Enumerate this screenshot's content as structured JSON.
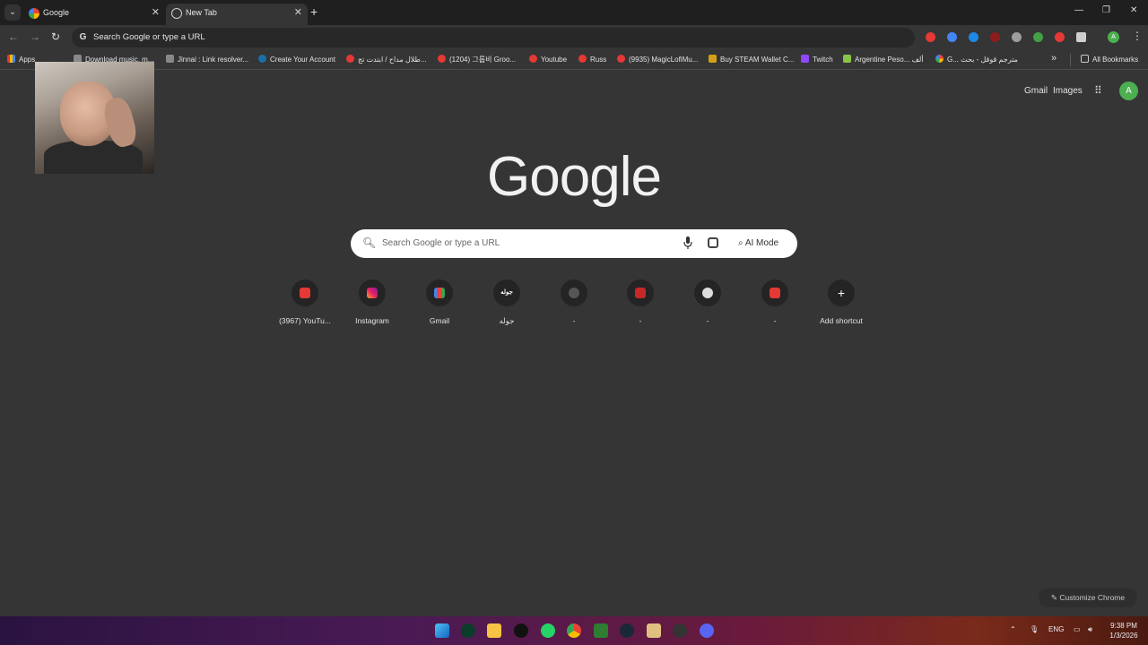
{
  "window": {
    "tabs": [
      {
        "title": "Google",
        "active": false
      },
      {
        "title": "New Tab",
        "active": true
      }
    ],
    "close_glyph": "✕",
    "new_tab_glyph": "+",
    "minimize_glyph": "—",
    "restore_glyph": "❐",
    "close_window_glyph": "✕"
  },
  "toolbar": {
    "omnibox_text": "Search Google or type a URL",
    "omnibox_icon": "G",
    "profile_initial": "A",
    "extensions": [
      "#e53935",
      "#4285f4",
      "#1e88e5",
      "#8d1c1c",
      "#9e9e9e",
      "#43a047",
      "#e53935",
      "#cfcfcf"
    ]
  },
  "bookmarks": {
    "items": [
      {
        "label": "Apps",
        "icon": "ic-apps"
      },
      {
        "label": "Download music, m...",
        "icon": "ic-gray"
      },
      {
        "label": "Jinnai : Link resolver...",
        "icon": "ic-gray"
      },
      {
        "label": "Create Your Account",
        "icon": "ic-steam"
      },
      {
        "label": "طلال مداح / ابتدت تج...",
        "icon": "ic-yt"
      },
      {
        "label": "(1204) 그룹비 Groo...",
        "icon": "ic-yt"
      },
      {
        "label": "Youtube",
        "icon": "ic-yt"
      },
      {
        "label": "Russ",
        "icon": "ic-yt"
      },
      {
        "label": "(9935) MagicLofiMu...",
        "icon": "ic-yt"
      },
      {
        "label": "Buy STEAM Wallet C...",
        "icon": "ic-shield"
      },
      {
        "label": "Twitch",
        "icon": "ic-twitch"
      },
      {
        "label": "Argentine Peso... ألف",
        "icon": "ic-seven"
      },
      {
        "label": "G... مترجم قوقل - بحث",
        "icon": "ic-g"
      }
    ],
    "more_glyph": "»",
    "all_bookmarks": "All Bookmarks"
  },
  "ntp": {
    "gmail": "Gmail",
    "images": "Images",
    "avatar_initial": "A",
    "logo": "Google",
    "search_placeholder": "Search Google or type a URL",
    "ai_mode": "AI Mode",
    "shortcuts": [
      {
        "label": "(3967) YouTu...",
        "icon": "sic-yt",
        "glyph": ""
      },
      {
        "label": "Instagram",
        "icon": "sic-ig",
        "glyph": ""
      },
      {
        "label": "Gmail",
        "icon": "sic-gm",
        "glyph": ""
      },
      {
        "label": "جوله",
        "icon": "sic-txt",
        "glyph": "جوله"
      },
      {
        "label": "-",
        "icon": "sic-dark",
        "glyph": ""
      },
      {
        "label": "-",
        "icon": "sic-top",
        "glyph": ""
      },
      {
        "label": "-",
        "icon": "sic-sp",
        "glyph": ""
      },
      {
        "label": "-",
        "icon": "sic-yt",
        "glyph": ""
      },
      {
        "label": "Add shortcut",
        "icon": "sic-plus",
        "glyph": "+"
      }
    ],
    "customize": "Customize Chrome"
  },
  "taskbar": {
    "language": "ENG",
    "time": "9:38 PM",
    "date": "1/3/2026"
  }
}
